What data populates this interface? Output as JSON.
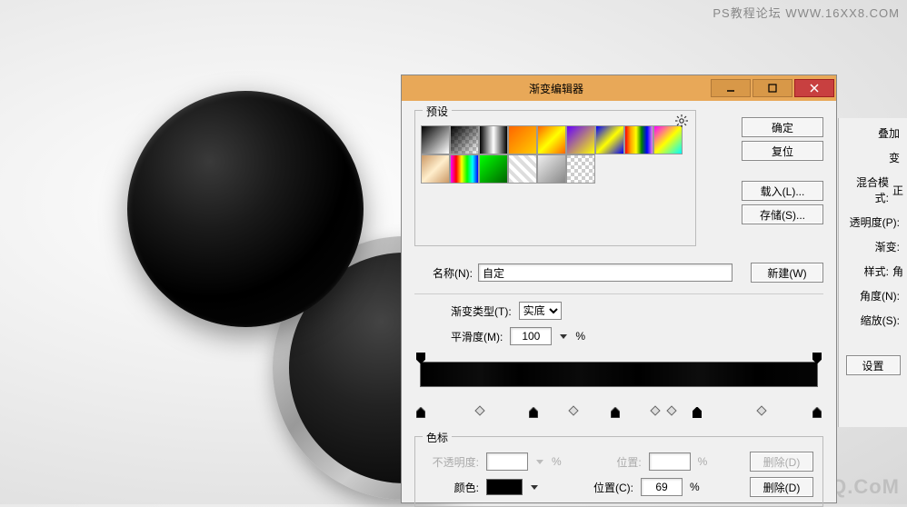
{
  "watermark_top": "PS教程论坛  WWW.16XX8.COM",
  "watermark_bot": "UiBQ.CoM",
  "dialog": {
    "title": "渐变编辑器",
    "preset_label": "预设",
    "buttons": {
      "ok": "确定",
      "reset": "复位",
      "load": "载入(L)...",
      "save": "存储(S)..."
    },
    "name_label": "名称(N):",
    "name_value": "自定",
    "new_btn": "新建(W)",
    "type_label": "渐变类型(T):",
    "type_value": "实底",
    "smooth_label": "平滑度(M):",
    "smooth_value": "100",
    "percent": "%",
    "stops_label": "色标",
    "opacity_label": "不透明度:",
    "position_label": "位置:",
    "color_label": "颜色:",
    "position_c_label": "位置(C):",
    "position_value": "69",
    "delete_d": "删除(D)",
    "delete_p": "删除(D)"
  },
  "side": {
    "overlay": "叠加",
    "grad": "变",
    "blend_mode": "混合模式:",
    "blend_value": "正",
    "opacity": "透明度(P):",
    "gradient": "渐变:",
    "style": "样式:",
    "style_value": "角",
    "angle": "角度(N):",
    "scale": "缩放(S):",
    "settings": "设置"
  }
}
